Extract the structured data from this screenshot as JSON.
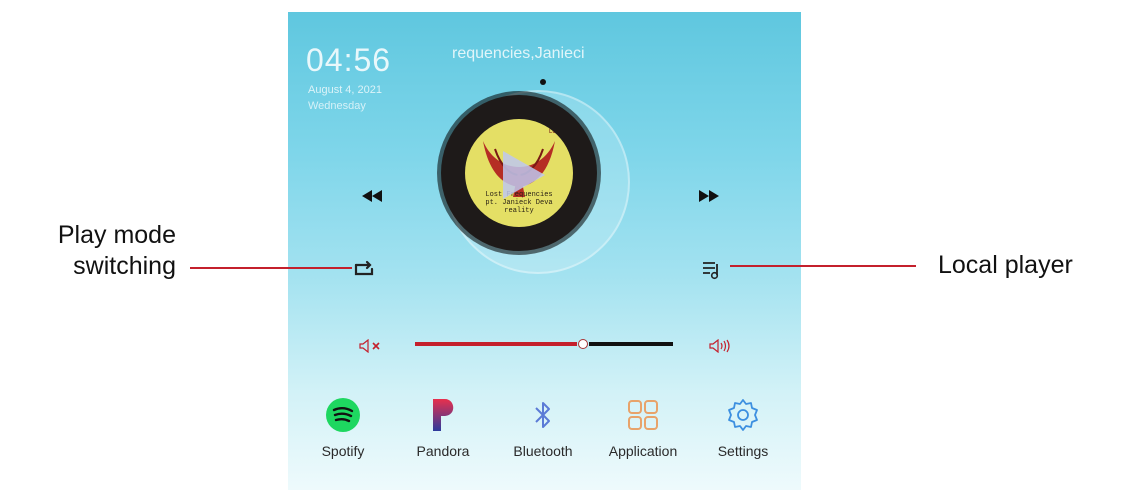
{
  "status": {
    "time": "04:56",
    "date": "August 4, 2021",
    "weekday": "Wednesday"
  },
  "now_playing": {
    "track": "requencies,Janieci",
    "album_lines": [
      "Lost Frequencies",
      "pt. Janieck Deva",
      "reality"
    ]
  },
  "controls": {
    "prev_icon": "rewind-icon",
    "next_icon": "fast-forward-icon",
    "mode_icon": "repeat-icon",
    "local_icon": "music-list-icon"
  },
  "volume": {
    "level": 0.65,
    "mute_icon": "speaker-mute-icon",
    "up_icon": "speaker-loud-icon",
    "color": "#c4202c"
  },
  "dock": [
    {
      "label": "Spotify",
      "icon": "spotify-icon",
      "color": "#1ed760"
    },
    {
      "label": "Pandora",
      "icon": "pandora-icon",
      "color": "#c0224a"
    },
    {
      "label": "Bluetooth",
      "icon": "bluetooth-icon",
      "color": "#5b7bd6"
    },
    {
      "label": "Application",
      "icon": "apps-grid-icon",
      "color": "#e8a36a"
    },
    {
      "label": "Settings",
      "icon": "gear-icon",
      "color": "#3c8fe0"
    }
  ],
  "annotations": {
    "left_line1": "Play mode",
    "left_line2": "switching",
    "right": "Local player",
    "line_color": "#c4202c"
  }
}
